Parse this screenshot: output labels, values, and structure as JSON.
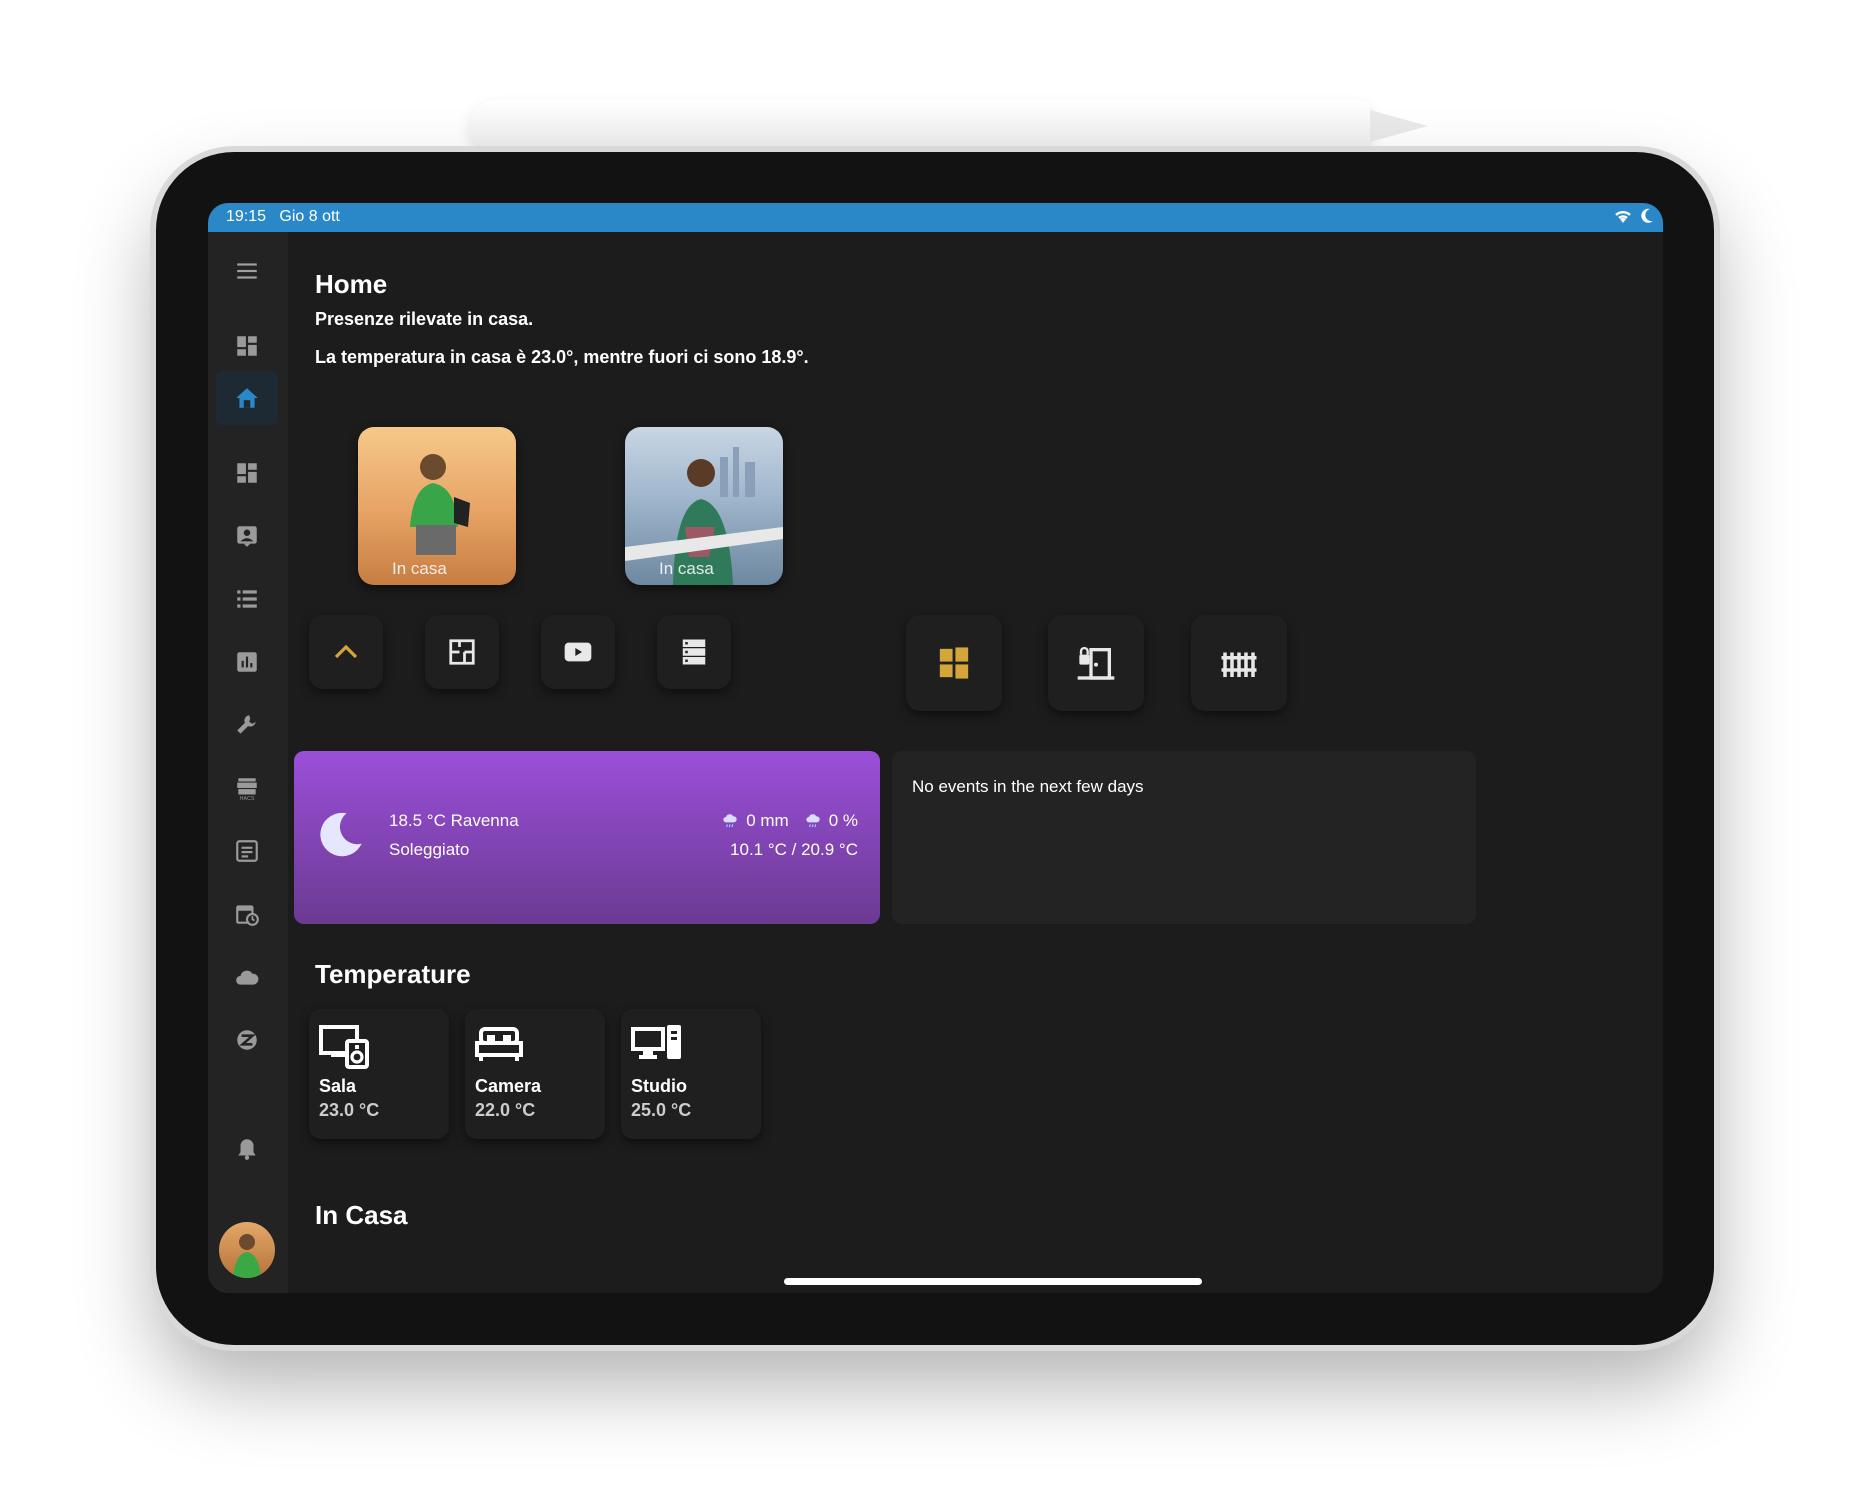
{
  "status_bar": {
    "time": "19:15",
    "date": "Gio 8 ott"
  },
  "sidebar": {
    "icons": [
      "menu-icon",
      "overview-icon",
      "home-icon",
      "dashboard-icon",
      "person-icon",
      "list-icon",
      "chart-icon",
      "wrench-icon",
      "hacs-icon",
      "logbook-icon",
      "calendar-icon",
      "cloud-icon",
      "zwave-icon"
    ],
    "bottom_icons": [
      "bell-icon"
    ]
  },
  "main": {
    "title": "Home",
    "line1": "Presenze rilevate in casa.",
    "line2": "La temperatura in casa è 23.0°, mentre fuori ci sono 18.9°."
  },
  "persons": [
    {
      "label": "In casa"
    },
    {
      "label": "In casa"
    }
  ],
  "quick_buttons_left": [
    "chevron-up-icon",
    "floorplan-icon",
    "youtube-icon",
    "server-icon"
  ],
  "quick_buttons_right": [
    "window-icon",
    "door-icon",
    "gate-icon"
  ],
  "colors": {
    "accent": "#2b88c8",
    "gold": "#d4a63a",
    "weather_top": "#9b4fd9",
    "weather_bottom": "#6b3a92",
    "bg": "#1c1c1c"
  },
  "weather": {
    "temp_city": "18.5 °C Ravenna",
    "condition": "Soleggiato",
    "rain": "0 mm",
    "rain_chance": "0 %",
    "range": "10.1 °C / 20.9 °C"
  },
  "events": {
    "text": "No events in the next few days"
  },
  "temperature_section": "Temperature",
  "rooms": [
    {
      "name": "Sala",
      "value": "23.0 °C",
      "icon": "tv-thermostat-icon"
    },
    {
      "name": "Camera",
      "value": "22.0 °C",
      "icon": "bed-icon"
    },
    {
      "name": "Studio",
      "value": "25.0 °C",
      "icon": "desktop-icon"
    }
  ],
  "in_casa_section": "In Casa"
}
